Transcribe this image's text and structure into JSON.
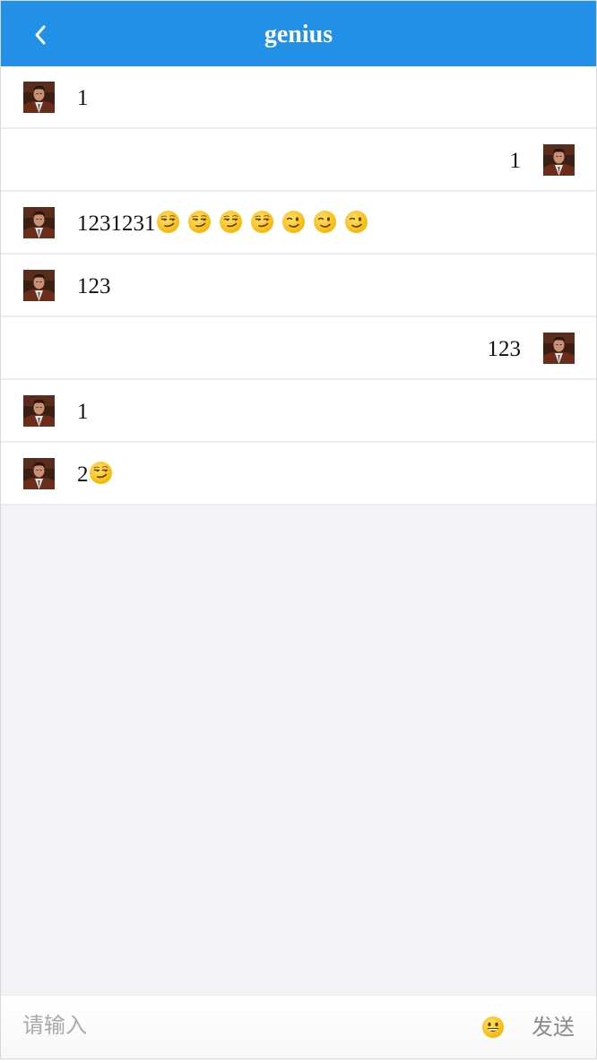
{
  "header": {
    "title": "genius",
    "back_icon": "chevron-left-icon",
    "background_color": "#2190e6"
  },
  "messages": [
    {
      "side": "left",
      "text": "1",
      "emojis": []
    },
    {
      "side": "right",
      "text": "1",
      "emojis": []
    },
    {
      "side": "left",
      "text": "1231231",
      "emojis": [
        "smirk",
        "smirk",
        "smirk",
        "smirk",
        "wink",
        "wink",
        "wink"
      ]
    },
    {
      "side": "left",
      "text": "123",
      "emojis": []
    },
    {
      "side": "right",
      "text": "123",
      "emojis": []
    },
    {
      "side": "left",
      "text": "1",
      "emojis": []
    },
    {
      "side": "left",
      "text": "2",
      "emojis": [
        "smirk"
      ]
    }
  ],
  "composer": {
    "placeholder": "请输入",
    "emoji_icon": "grinning-face-icon",
    "send_label": "发送"
  }
}
